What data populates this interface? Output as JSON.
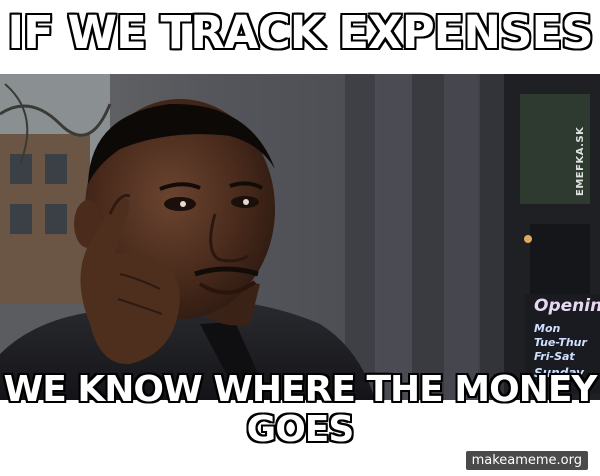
{
  "meme": {
    "top_text": "IF WE TRACK EXPENSES",
    "bottom_text_line1": "WE KNOW WHERE THE MONEY",
    "bottom_text_line2": "GOES",
    "side_watermark": "EMEFKA.SK",
    "site_watermark": "makeameme.org"
  },
  "sign": {
    "title": "Openin",
    "line1": "Mon",
    "line2": "Tue-Thur",
    "line3": "Fri-Sat",
    "line4": "Sunday"
  },
  "colors": {
    "caption_fill": "#ffffff",
    "caption_outline": "#000000",
    "background": "#ffffff"
  }
}
